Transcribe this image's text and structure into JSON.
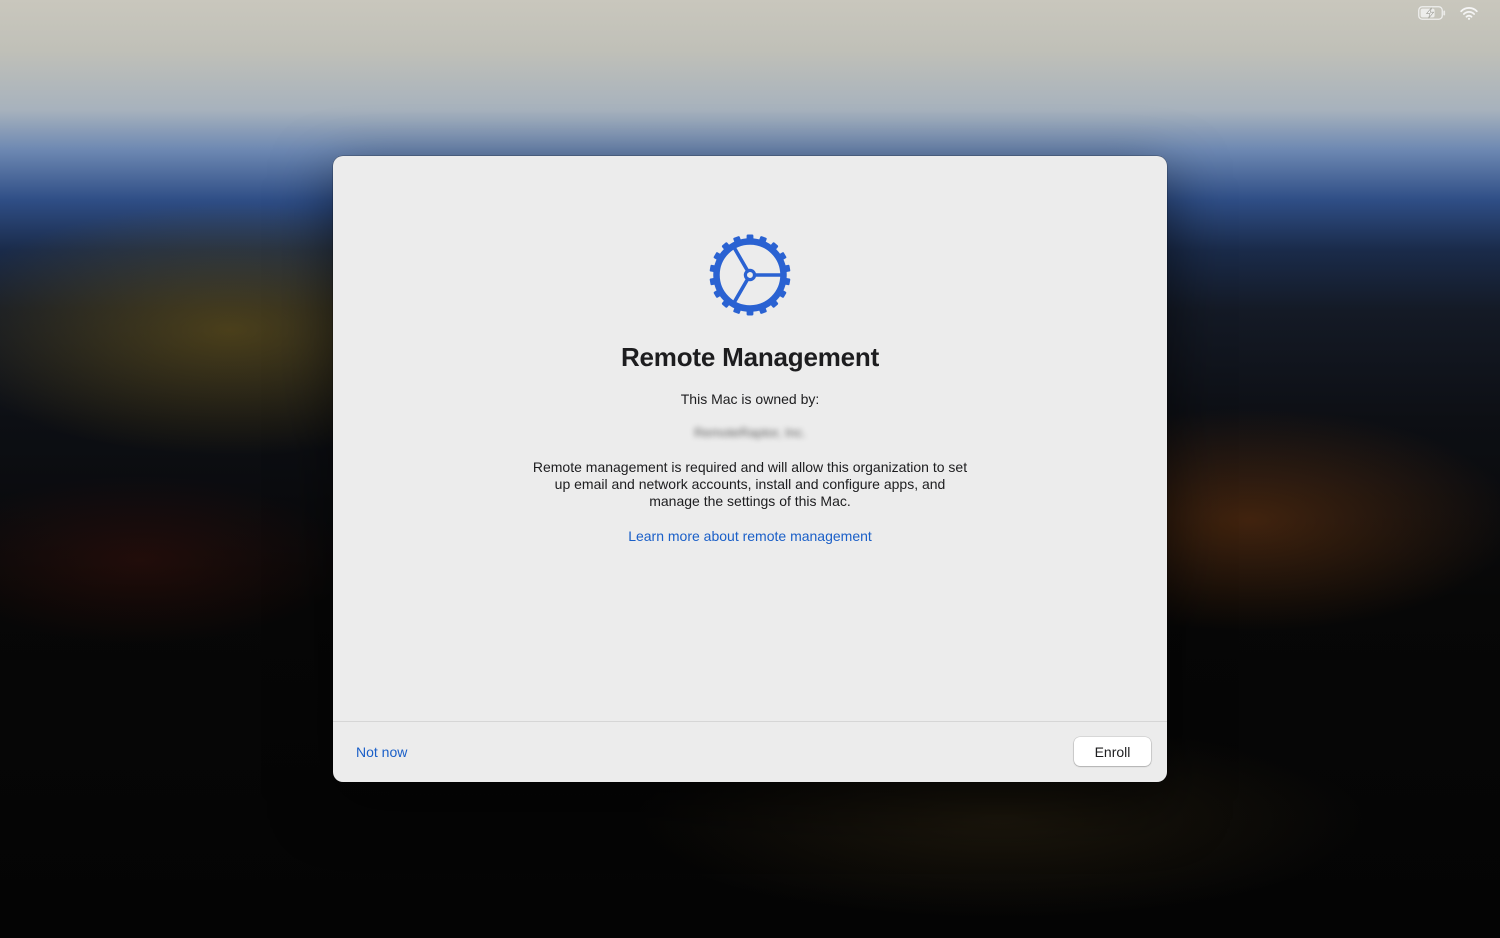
{
  "status_bar": {
    "battery_icon": "battery-charging-icon",
    "wifi_icon": "wifi-icon"
  },
  "dialog": {
    "icon": "gear-icon",
    "title": "Remote Management",
    "owned_by_label": "This Mac is owned by:",
    "organization_name": "RemoteRaptor, Inc.",
    "description": "Remote management is required and will allow this organization to set up email and network accounts, install and configure apps, and manage the settings of this Mac.",
    "learn_more_link": "Learn more about remote management"
  },
  "footer": {
    "not_now_label": "Not now",
    "enroll_label": "Enroll"
  },
  "colors": {
    "accent": "#1a5fc8",
    "gear_blue": "#2a62d2",
    "dialog_background": "#ececec"
  }
}
